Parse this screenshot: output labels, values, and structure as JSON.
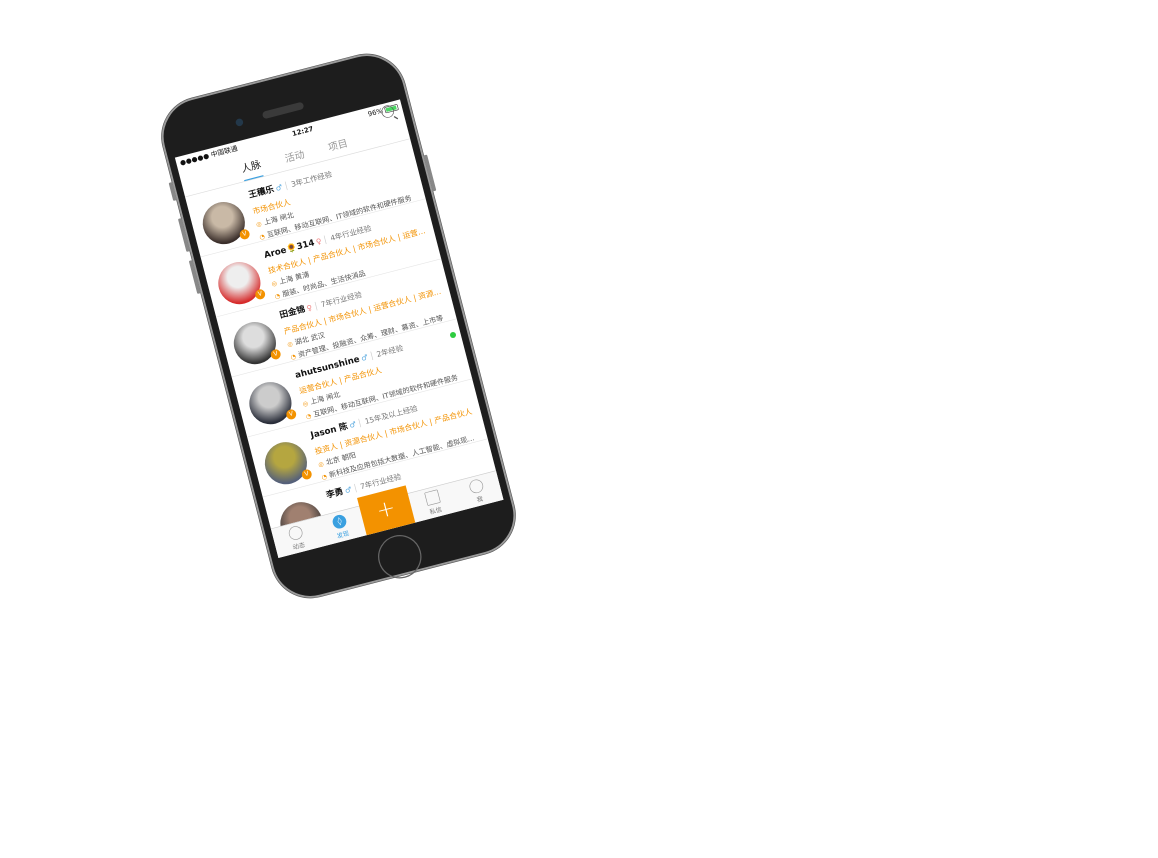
{
  "status": {
    "carrier": "●●●●● 中国联通",
    "time": "12:27",
    "battery": "96%"
  },
  "tabs": [
    "人脉",
    "活动",
    "项目"
  ],
  "people": [
    {
      "name": "王穰乐",
      "gender": "♂",
      "exp": "3年工作经验",
      "roles": "市场合伙人",
      "location": "上海 闸北",
      "industry": "互联网、移动互联网、IT领域的软件和硬件服务",
      "avatar": [
        "#c9b9a6",
        "#3a2e2a"
      ]
    },
    {
      "name": "Aroe🌻314",
      "gender": "♀",
      "exp": "4年行业经验",
      "roles": "技术合伙人 | 产品合伙人 | 市场合伙人 | 运营合伙...",
      "location": "上海 黄浦",
      "industry": "服装、时尚品、生活快消品",
      "avatar": [
        "#eee",
        "#d62b2b"
      ]
    },
    {
      "name": "田金锦",
      "gender": "♀",
      "exp": "7年行业经验",
      "roles": "产品合伙人 | 市场合伙人 | 运营合伙人 | 资源合伙...",
      "location": "湖北 武汉",
      "industry": "资产管理、投融资、众筹、理财、募资、上市等",
      "avatar": [
        "#ddd",
        "#333"
      ]
    },
    {
      "name": "ahutsunshine",
      "gender": "♂",
      "exp": "2年经验",
      "roles": "运营合伙人 | 产品合伙人",
      "location": "上海 闸北",
      "industry": "互联网、移动互联网、IT领域的软件和硬件服务",
      "avatar": [
        "#ccc",
        "#2a2e3a"
      ]
    },
    {
      "name": "Jason 陈",
      "gender": "♂",
      "exp": "15年及以上经验",
      "roles": "投资人 | 资源合伙人 | 市场合伙人 | 产品合伙人",
      "location": "北京 朝阳",
      "industry": "新科技及应用包括大数据、人工智能、虚拟现实、...",
      "avatar": [
        "#b5a640",
        "#55607a"
      ]
    },
    {
      "name": "李勇",
      "gender": "♂",
      "exp": "7年行业经验",
      "roles": "",
      "location": "",
      "industry": "",
      "avatar": [
        "#a08070",
        "#333"
      ]
    }
  ],
  "badge": "V",
  "tabbar": {
    "dynamic": "动态",
    "discover": "发现",
    "plus": "+",
    "messages": "私信",
    "me": "我"
  }
}
